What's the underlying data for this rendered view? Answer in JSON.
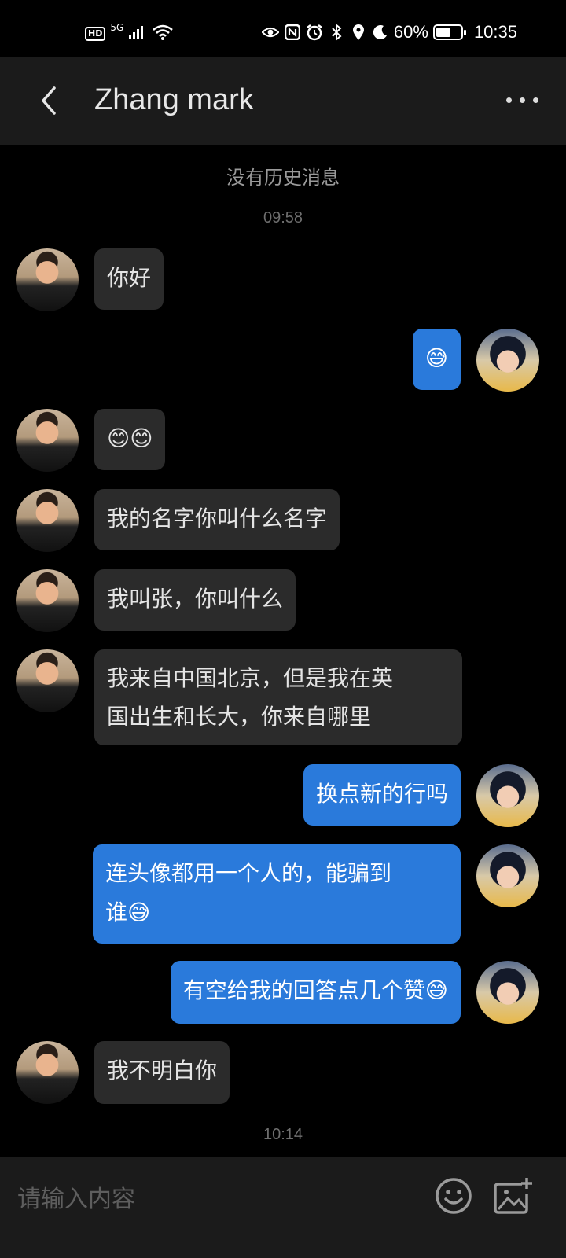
{
  "status_bar": {
    "hd": "HD",
    "network": "5G",
    "battery_percent": "60%",
    "battery_level": 0.6,
    "time": "10:35",
    "icons": [
      "eye-icon",
      "nfc-icon",
      "alarm-icon",
      "bluetooth-icon",
      "location-icon",
      "moon-icon"
    ]
  },
  "header": {
    "title": "Zhang mark",
    "back_icon": "chevron-left-icon",
    "more_icon": "more-dots-icon"
  },
  "chat": {
    "no_history": "没有历史消息",
    "time_1": "09:58",
    "time_2": "10:14",
    "messages": [
      {
        "from": "them",
        "text": "你好"
      },
      {
        "from": "me",
        "text": "😅"
      },
      {
        "from": "them",
        "text": "😊😊"
      },
      {
        "from": "them",
        "text": "我的名字你叫什么名字"
      },
      {
        "from": "them",
        "text": "我叫张，你叫什么"
      },
      {
        "from": "them",
        "line1": "我来自中国北京，但是我在英",
        "line2": "国出生和长大，你来自哪里"
      },
      {
        "from": "me",
        "text": "换点新的行吗"
      },
      {
        "from": "me",
        "line1": "连头像都用一个人的，能骗到",
        "line2": "谁😅"
      },
      {
        "from": "me",
        "text": "有空给我的回答点几个赞😅"
      },
      {
        "from": "them",
        "text": "我不明白你"
      }
    ]
  },
  "input": {
    "placeholder": "请输入内容",
    "value": "",
    "emoji_icon": "emoji-smile-icon",
    "image_icon": "add-image-icon"
  },
  "colors": {
    "outgoing_bubble": "#2a7adb",
    "incoming_bubble": "#2b2b2b",
    "background": "#000000",
    "header": "#1b1b1b"
  }
}
